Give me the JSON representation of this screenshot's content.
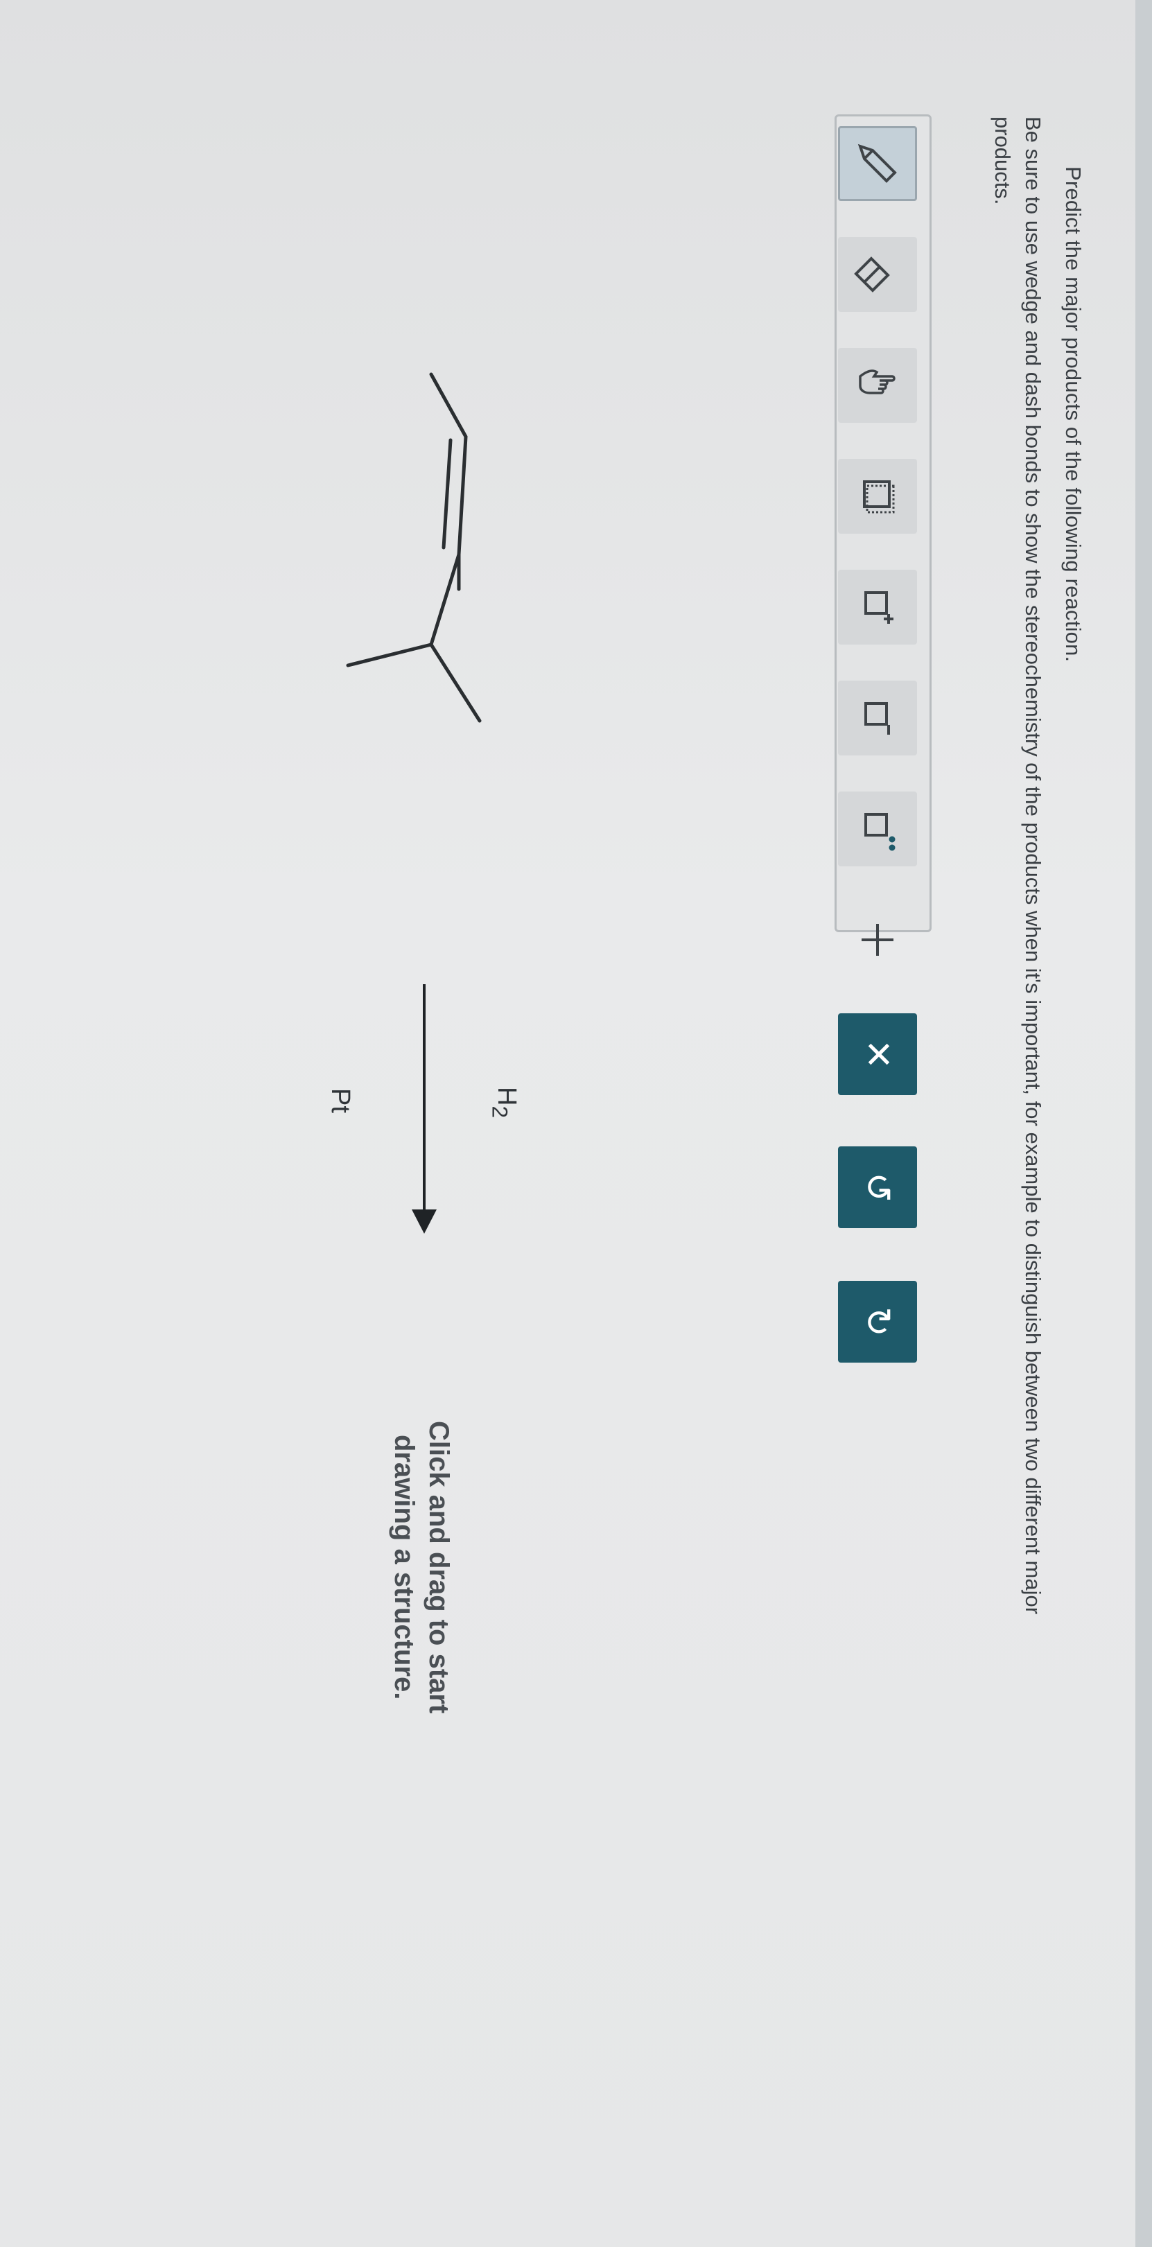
{
  "question": {
    "line1": "Predict the major products of the following reaction.",
    "line2": "Be sure to use wedge and dash bonds to show the stereochemistry of the products when it's important, for example to distinguish between two different major",
    "line3": "products."
  },
  "toolbar": {
    "tools": [
      {
        "name": "pencil-tool",
        "glyph": "✎"
      },
      {
        "name": "eraser-tool",
        "glyph": "⌫"
      },
      {
        "name": "hand-tool",
        "glyph": "☝"
      },
      {
        "name": "select-tool",
        "glyph": "⬚"
      },
      {
        "name": "positive-charge-tool",
        "glyph": "□⁺"
      },
      {
        "name": "negative-charge-tool",
        "glyph": "□⁻"
      },
      {
        "name": "lone-pair-tool",
        "glyph": "□:"
      },
      {
        "name": "add-tool",
        "glyph": "+"
      }
    ],
    "clear_glyph": "✕",
    "undo_glyph": "↺",
    "redo_glyph": "↻"
  },
  "reaction": {
    "reagent_top": "H",
    "reagent_top_sub": "2",
    "reagent_bottom": "Pt"
  },
  "canvas": {
    "hint_line1": "Click and drag to start",
    "hint_line2": "drawing a structure."
  },
  "colors": {
    "accent": "#1e5a6a",
    "text": "#3a3f44"
  }
}
